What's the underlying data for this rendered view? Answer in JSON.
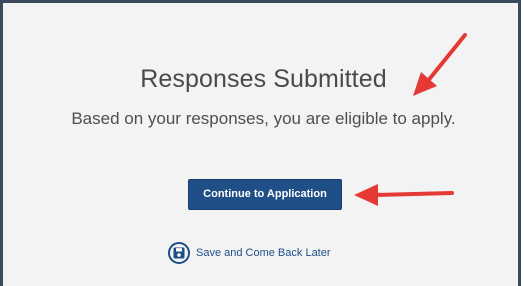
{
  "panel": {
    "title": "Responses Submitted",
    "message": "Based on your responses, you are eligible to apply."
  },
  "actions": {
    "continue_label": "Continue to Application",
    "save_label": "Save and Come Back Later",
    "save_icon": "floppy-disk-icon"
  },
  "annotations": {
    "arrow_color": "#e53935"
  },
  "colors": {
    "primary": "#1f4f86",
    "panel_background": "#f3f3f3",
    "frame_border": "#3a4a5c"
  }
}
